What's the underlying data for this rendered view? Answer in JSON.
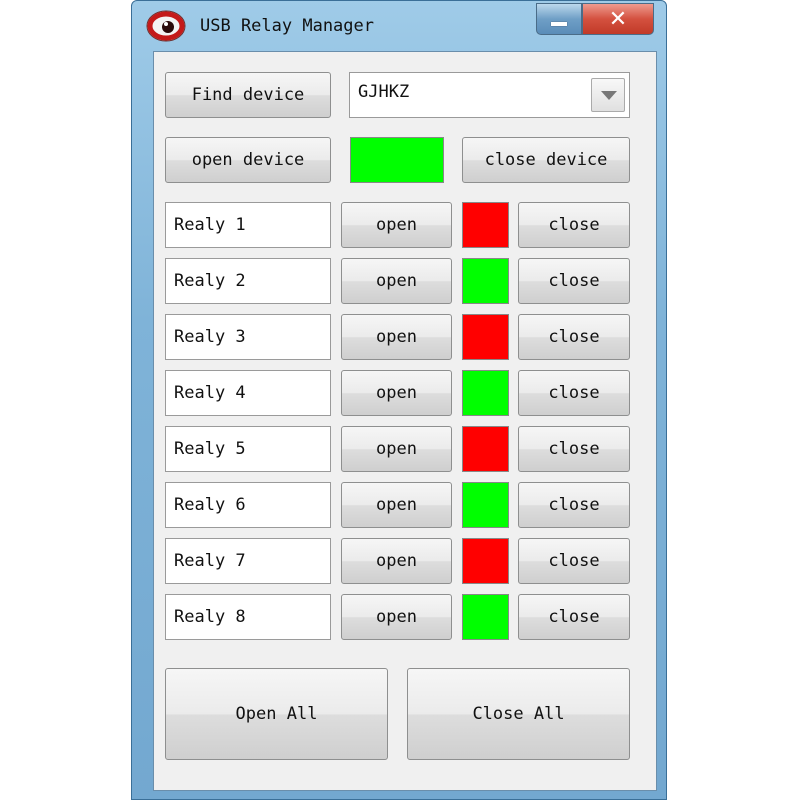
{
  "window": {
    "title": "USB Relay Manager"
  },
  "device": {
    "find_label": "Find device",
    "selected": "GJHKZ",
    "open_label": "open device",
    "close_label": "close device",
    "status_color": "#00ff00"
  },
  "relays": [
    {
      "name": "Realy 1",
      "open_label": "open",
      "close_label": "close",
      "status": "off",
      "color": "#ff0000"
    },
    {
      "name": "Realy 2",
      "open_label": "open",
      "close_label": "close",
      "status": "on",
      "color": "#00ff00"
    },
    {
      "name": "Realy 3",
      "open_label": "open",
      "close_label": "close",
      "status": "off",
      "color": "#ff0000"
    },
    {
      "name": "Realy 4",
      "open_label": "open",
      "close_label": "close",
      "status": "on",
      "color": "#00ff00"
    },
    {
      "name": "Realy 5",
      "open_label": "open",
      "close_label": "close",
      "status": "off",
      "color": "#ff0000"
    },
    {
      "name": "Realy 6",
      "open_label": "open",
      "close_label": "close",
      "status": "on",
      "color": "#00ff00"
    },
    {
      "name": "Realy 7",
      "open_label": "open",
      "close_label": "close",
      "status": "off",
      "color": "#ff0000"
    },
    {
      "name": "Realy 8",
      "open_label": "open",
      "close_label": "close",
      "status": "on",
      "color": "#00ff00"
    }
  ],
  "bulk": {
    "open_all_label": "Open All",
    "close_all_label": "Close All"
  },
  "icons": {
    "app": "eye-icon",
    "minimize": "minimize-icon",
    "close": "close-icon",
    "dropdown": "chevron-down-icon"
  }
}
